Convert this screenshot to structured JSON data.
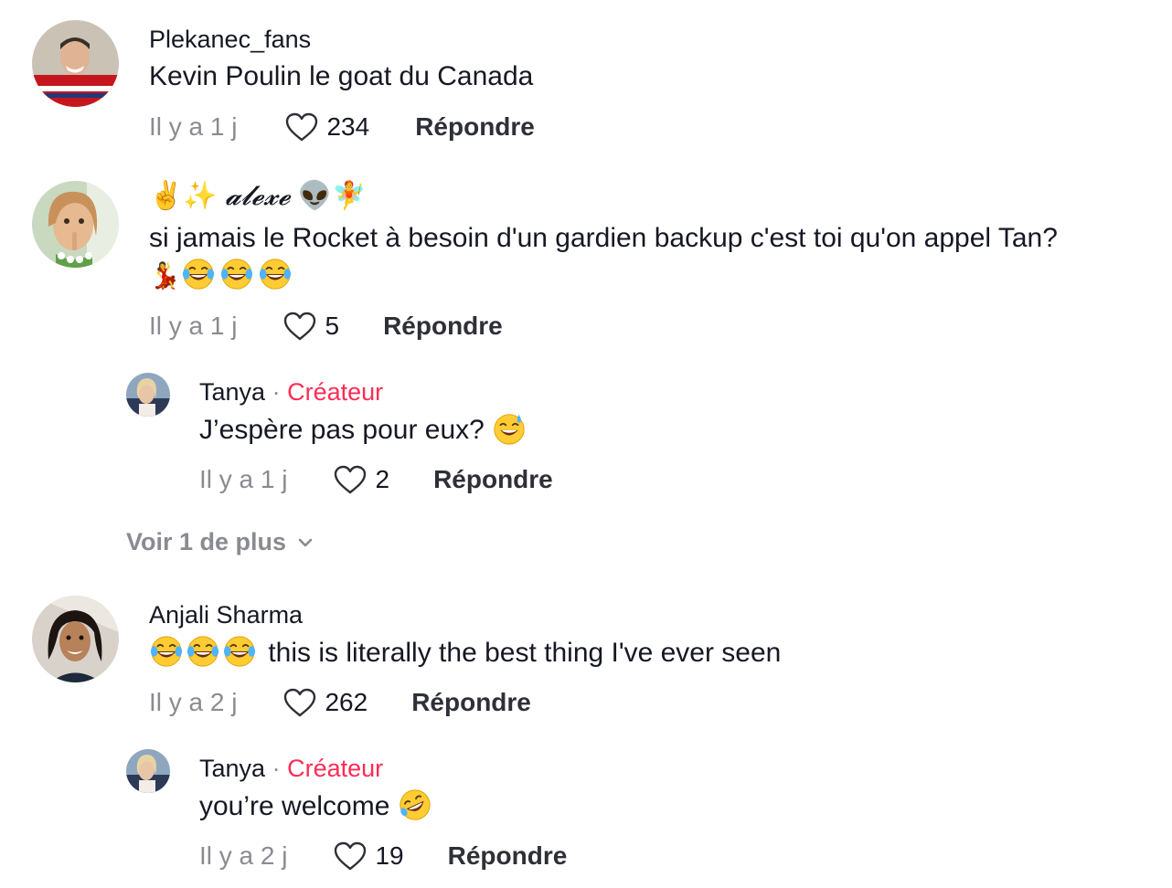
{
  "comments": [
    {
      "username": "Plekanec_fans",
      "text": "Kevin Poulin le goat du Canada",
      "time": "Il y a 1 j",
      "likes": "234",
      "reply_label": "Répondre"
    },
    {
      "username": "𝓪𝓵𝓮𝔁𝓮",
      "text_line1": "si jamais le Rocket à besoin d'un gardien backup c'est toi qu'on appel Tan?",
      "time": "Il y a 1 j",
      "likes": "5",
      "reply_label": "Répondre"
    },
    {
      "username": "Tanya",
      "creator_label": "Créateur",
      "text": "J’espère pas pour eux?",
      "time": "Il y a 1 j",
      "likes": "2",
      "reply_label": "Répondre"
    },
    {
      "username": "Anjali Sharma",
      "text": "this is literally the best thing I've ever seen",
      "time": "Il y a 2 j",
      "likes": "262",
      "reply_label": "Répondre"
    },
    {
      "username": "Tanya",
      "creator_label": "Créateur",
      "text": "you’re welcome",
      "time": "Il y a 2 j",
      "likes": "19",
      "reply_label": "Répondre"
    }
  ],
  "view_more": "Voir 1 de plus",
  "separator": "·",
  "icons": {
    "like": "heart-outline-icon",
    "expand": "chevron-down-icon",
    "laugh": "face-with-tears-of-joy-emoji",
    "rofl": "rolling-on-floor-laughing-emoji",
    "sweat": "grinning-face-with-sweat-emoji"
  },
  "colors": {
    "creator": "#fe2c55",
    "secondary_text": "#8a8b91",
    "primary_text": "#161823"
  }
}
